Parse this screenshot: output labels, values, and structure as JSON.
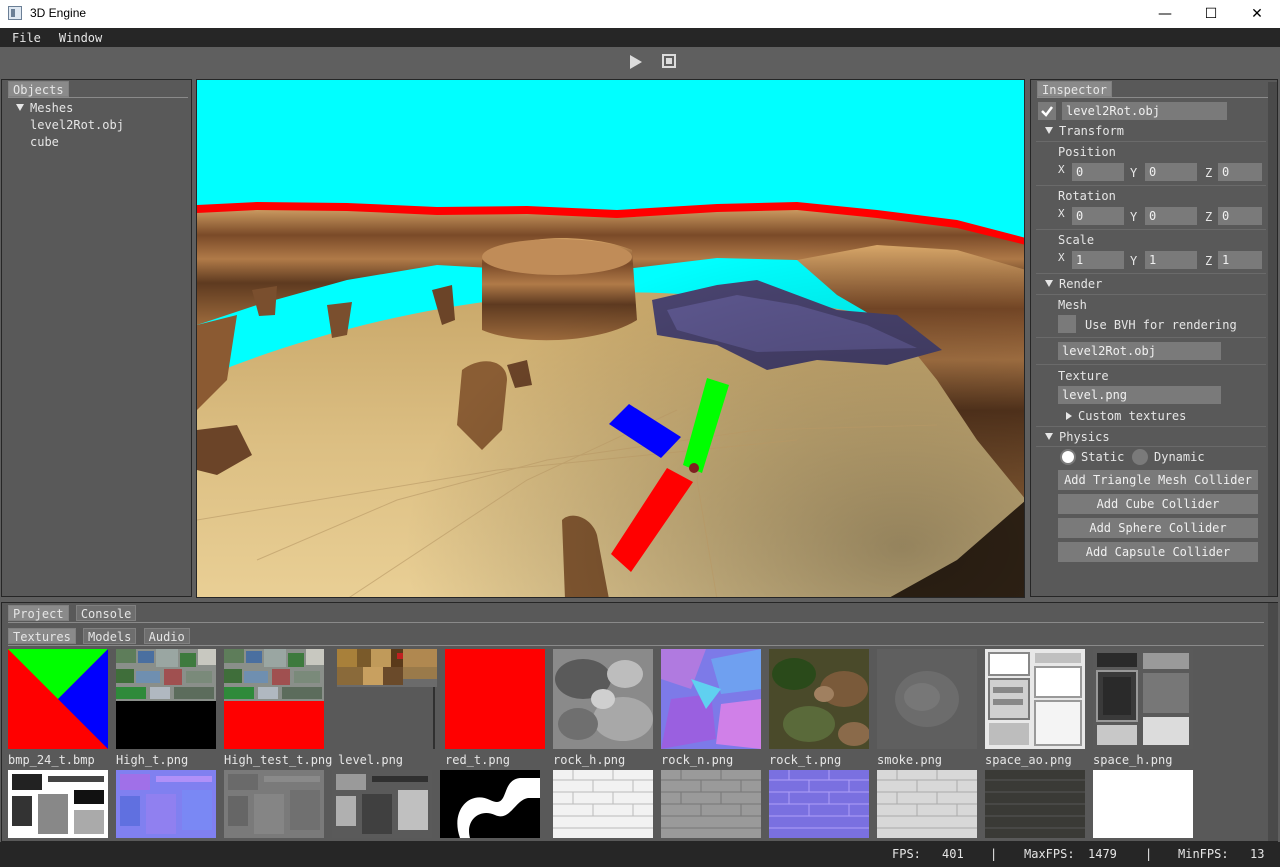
{
  "window": {
    "title": "3D Engine"
  },
  "menu": {
    "items": [
      "File",
      "Window"
    ]
  },
  "objects_panel": {
    "tab": "Objects",
    "group": "Meshes",
    "items": [
      "level2Rot.obj",
      "cube"
    ]
  },
  "inspector": {
    "tab": "Inspector",
    "object_name": "level2Rot.obj",
    "transform": {
      "header": "Transform",
      "position_label": "Position",
      "rotation_label": "Rotation",
      "scale_label": "Scale",
      "axis_x": "X",
      "axis_y": "Y",
      "axis_z": "Z",
      "position": [
        "0",
        "0",
        "0"
      ],
      "rotation": [
        "0",
        "0",
        "0"
      ],
      "scale": [
        "1",
        "1",
        "1"
      ]
    },
    "render": {
      "header": "Render",
      "mesh_label": "Mesh",
      "bvh_label": "Use BVH for rendering",
      "mesh_value": "level2Rot.obj",
      "texture_label": "Texture",
      "texture_value": "level.png",
      "custom_textures": "Custom textures"
    },
    "physics": {
      "header": "Physics",
      "static_label": "Static",
      "dynamic_label": "Dynamic",
      "buttons": [
        "Add Triangle Mesh Collider",
        "Add Cube Collider",
        "Add Sphere Collider",
        "Add Capsule Collider"
      ]
    }
  },
  "project_panel": {
    "tabs": [
      "Project",
      "Console"
    ],
    "subtabs": [
      "Textures",
      "Models",
      "Audio"
    ],
    "thumbnails": [
      "bmp_24_t.bmp",
      "High_t.png",
      "High_test_t.png",
      "level.png",
      "red_t.png",
      "rock_h.png",
      "rock_n.png",
      "rock_t.png",
      "smoke.png",
      "space_ao.png",
      "space_h.png"
    ]
  },
  "status": {
    "fps_label": "FPS:",
    "fps": "401",
    "maxfps_label": "MaxFPS:",
    "maxfps": "1479",
    "minfps_label": "MinFPS:",
    "minfps": "13",
    "sep": "|"
  },
  "colors": {
    "sky": "#00ffff",
    "gizmo_x": "#ff0000",
    "gizmo_y": "#00ff00",
    "gizmo_z": "#0000ff",
    "panel_bg": "#595959",
    "menubar_bg": "#262626"
  }
}
